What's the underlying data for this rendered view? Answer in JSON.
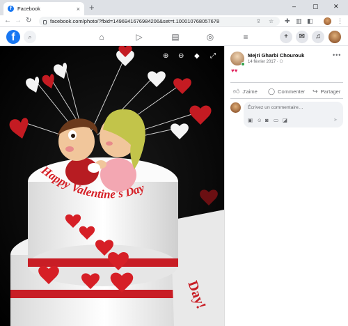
{
  "browser": {
    "tab_title": "Facebook",
    "tab_favicon": "f",
    "url": "facebook.com/photo/?fbid=1496941676984206&set=t.100010768057678"
  },
  "photo_viewer": {
    "cake_text": "Happy Valentine's Day",
    "toolbar": [
      "zoom-in-icon",
      "zoom-out-icon",
      "tag-icon",
      "fullscreen-icon"
    ]
  },
  "post": {
    "author": "Mejri Gharbi Chourouk",
    "date": "14 février 2017",
    "privacy_icon": "friends-icon",
    "reaction": "♥♥",
    "actions": {
      "like": "J'aime",
      "comment": "Commenter",
      "share": "Partager"
    },
    "comment_placeholder": "Écrivez un commentaire…"
  },
  "colors": {
    "fb_blue": "#1877f2",
    "reaction_red": "#e0245e"
  }
}
